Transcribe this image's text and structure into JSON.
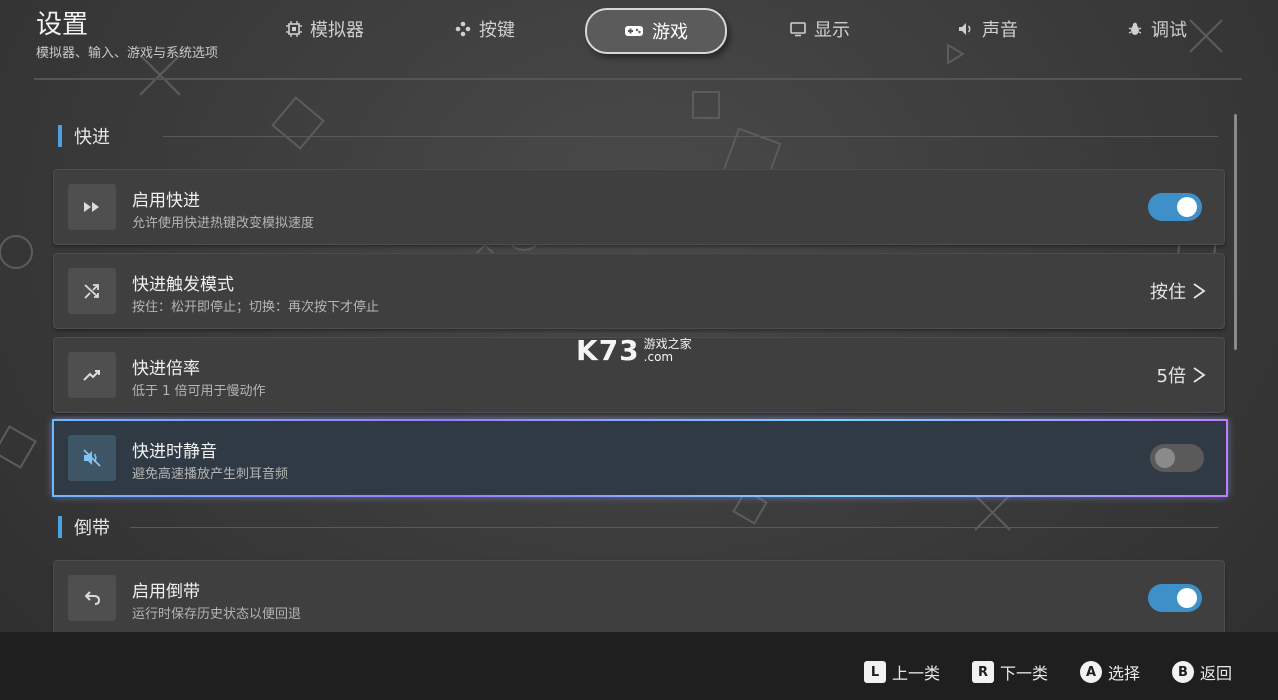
{
  "header": {
    "title": "设置",
    "subtitle": "模拟器、输入、游戏与系统选项"
  },
  "tabs": [
    {
      "label": "模拟器",
      "icon": "chip-icon"
    },
    {
      "label": "按键",
      "icon": "gamepad-buttons-icon"
    },
    {
      "label": "游戏",
      "icon": "controller-icon",
      "active": true
    },
    {
      "label": "显示",
      "icon": "monitor-icon"
    },
    {
      "label": "声音",
      "icon": "speaker-icon"
    },
    {
      "label": "调试",
      "icon": "bug-icon"
    }
  ],
  "sections": {
    "fast_forward": "快进",
    "rewind": "倒带"
  },
  "rows": {
    "enable_ff": {
      "title": "启用快进",
      "desc": "允许使用快进热键改变模拟速度",
      "toggle": true
    },
    "ff_mode": {
      "title": "快进触发模式",
      "desc": "按住：松开即停止；切换：再次按下才停止",
      "value": "按住"
    },
    "ff_rate": {
      "title": "快进倍率",
      "desc": "低于 1 倍可用于慢动作",
      "value": "5倍"
    },
    "ff_mute": {
      "title": "快进时静音",
      "desc": "避免高速播放产生刺耳音频",
      "toggle": false
    },
    "enable_rewind": {
      "title": "启用倒带",
      "desc": "运行时保存历史状态以便回退",
      "toggle": true
    }
  },
  "footer": {
    "prev": {
      "key": "L",
      "label": "上一类"
    },
    "next": {
      "key": "R",
      "label": "下一类"
    },
    "select": {
      "key": "A",
      "label": "选择"
    },
    "back": {
      "key": "B",
      "label": "返回"
    }
  },
  "watermark": {
    "big": "K73",
    "line1": "游戏之家",
    "line2": ".com"
  },
  "colors": {
    "accent": "#4aa3e0",
    "toggle_on": "#3f8fc9",
    "background": "#3a3a3a",
    "footer": "#1f1f1f"
  }
}
